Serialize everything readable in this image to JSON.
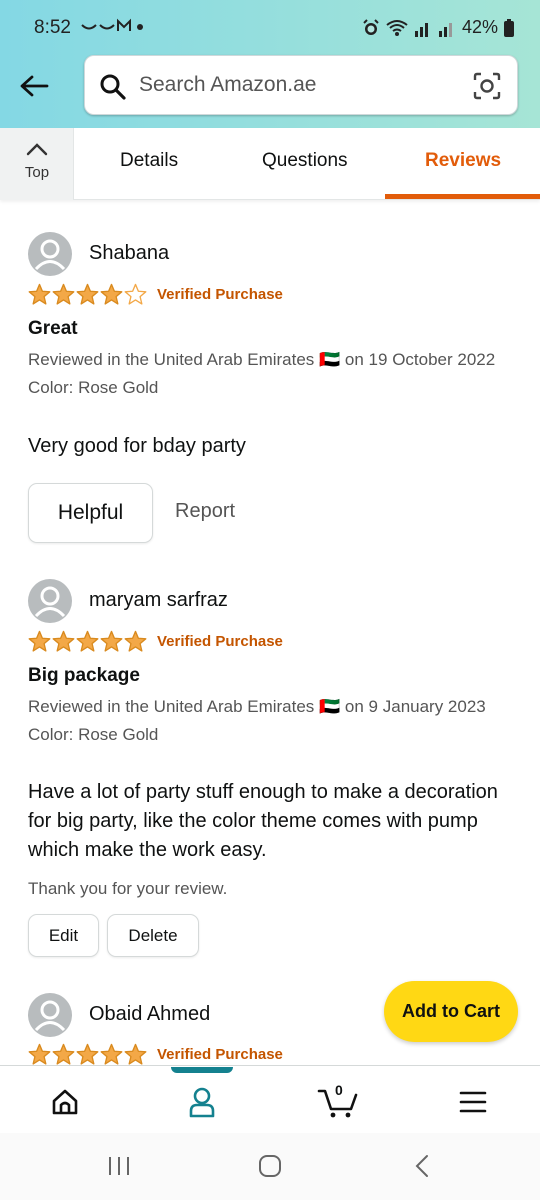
{
  "status_bar": {
    "time": "8:52",
    "left_icons": "⌣⌣M •",
    "battery_percent": "42%"
  },
  "header": {
    "search_placeholder": "Search Amazon.ae"
  },
  "subnav": {
    "top_label": "Top",
    "tabs": [
      {
        "label": "Details"
      },
      {
        "label": "Questions"
      },
      {
        "label": "Reviews",
        "active": true
      }
    ]
  },
  "colors": {
    "accent_orange": "#e25c0a",
    "star": "#f3a847",
    "verified": "#c45500",
    "add_to_cart": "#ffd814",
    "nav_indicator": "#14818f"
  },
  "reviews": [
    {
      "name": "Shabana",
      "rating": 4,
      "verified": "Verified Purchase",
      "title": "Great",
      "meta": "Reviewed in the United Arab Emirates 🇦🇪 on 19 October 2022",
      "color": "Color: Rose Gold",
      "body": "Very good for bday party",
      "helpful_label": "Helpful",
      "report_label": "Report"
    },
    {
      "name": "maryam sarfraz",
      "rating": 5,
      "verified": "Verified Purchase",
      "title": "Big package",
      "meta": "Reviewed in the United Arab Emirates 🇦🇪 on 9 January 2023",
      "color": "Color: Rose Gold",
      "body": "Have a lot of party stuff enough to make a decoration for big party, like the color theme comes with pump which make the work easy.",
      "thanks": "Thank you for your review.",
      "edit_label": "Edit",
      "delete_label": "Delete"
    },
    {
      "name": "Obaid Ahmed",
      "rating": 5,
      "verified": "Verified Purchase"
    }
  ],
  "add_to_cart_label": "Add to Cart",
  "bottom_nav": {
    "items": [
      "home-icon",
      "account-icon",
      "cart-icon",
      "menu-icon"
    ],
    "cart_count": "0",
    "active_index": 1
  }
}
